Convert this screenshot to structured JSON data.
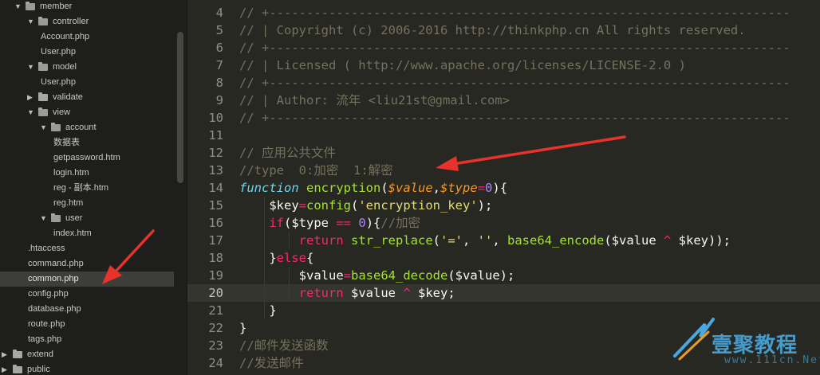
{
  "sidebar": {
    "items": [
      {
        "label": "member",
        "kind": "folder-open"
      },
      {
        "label": "controller",
        "kind": "folder-open"
      },
      {
        "label": "Account.php",
        "kind": "file"
      },
      {
        "label": "User.php",
        "kind": "file"
      },
      {
        "label": "model",
        "kind": "folder-open"
      },
      {
        "label": "User.php",
        "kind": "file"
      },
      {
        "label": "validate",
        "kind": "folder-closed"
      },
      {
        "label": "view",
        "kind": "folder-open"
      },
      {
        "label": "account",
        "kind": "folder-open"
      },
      {
        "label": "数据表",
        "kind": "file"
      },
      {
        "label": "getpassword.htm",
        "kind": "file"
      },
      {
        "label": "login.htm",
        "kind": "file"
      },
      {
        "label": "reg - 副本.htm",
        "kind": "file"
      },
      {
        "label": "reg.htm",
        "kind": "file"
      },
      {
        "label": "user",
        "kind": "folder-open"
      },
      {
        "label": "index.htm",
        "kind": "file"
      },
      {
        "label": ".htaccess",
        "kind": "file"
      },
      {
        "label": "command.php",
        "kind": "file"
      },
      {
        "label": "common.php",
        "kind": "file",
        "selected": true
      },
      {
        "label": "config.php",
        "kind": "file"
      },
      {
        "label": "database.php",
        "kind": "file"
      },
      {
        "label": "route.php",
        "kind": "file"
      },
      {
        "label": "tags.php",
        "kind": "file"
      },
      {
        "label": "extend",
        "kind": "folder-closed"
      },
      {
        "label": "public",
        "kind": "folder-closed"
      }
    ]
  },
  "editor": {
    "current_line": "20",
    "lines": [
      {
        "num": "4",
        "tokens": [
          [
            "c",
            "// +----------------------------------------------------------------------"
          ]
        ]
      },
      {
        "num": "5",
        "tokens": [
          [
            "c",
            "// | Copyright (c) 2006-2016 http://thinkphp.cn All rights reserved."
          ]
        ]
      },
      {
        "num": "6",
        "tokens": [
          [
            "c",
            "// +----------------------------------------------------------------------"
          ]
        ]
      },
      {
        "num": "7",
        "tokens": [
          [
            "c",
            "// | Licensed ( http://www.apache.org/licenses/LICENSE-2.0 )"
          ]
        ]
      },
      {
        "num": "8",
        "tokens": [
          [
            "c",
            "// +----------------------------------------------------------------------"
          ]
        ]
      },
      {
        "num": "9",
        "tokens": [
          [
            "c",
            "// | Author: 流年 <liu21st@gmail.com>"
          ]
        ]
      },
      {
        "num": "10",
        "tokens": [
          [
            "c",
            "// +----------------------------------------------------------------------"
          ]
        ]
      },
      {
        "num": "11",
        "tokens": []
      },
      {
        "num": "12",
        "tokens": [
          [
            "c",
            "// 应用公共文件"
          ]
        ]
      },
      {
        "num": "13",
        "tokens": [
          [
            "c",
            "//type  0:加密  1:解密"
          ]
        ]
      },
      {
        "num": "14",
        "tokens": [
          [
            "d",
            "function"
          ],
          [
            "p",
            " "
          ],
          [
            "f",
            "encryption"
          ],
          [
            "p",
            "("
          ],
          [
            "v",
            "$value"
          ],
          [
            "p",
            ","
          ],
          [
            "v",
            "$type"
          ],
          [
            "k",
            "="
          ],
          [
            "n",
            "0"
          ],
          [
            "p",
            "){"
          ]
        ]
      },
      {
        "num": "15",
        "tokens": [
          [
            "p",
            "    $key"
          ],
          [
            "k",
            "="
          ],
          [
            "f",
            "config"
          ],
          [
            "p",
            "("
          ],
          [
            "s",
            "'encryption_key'"
          ],
          [
            "p",
            ");"
          ]
        ]
      },
      {
        "num": "16",
        "tokens": [
          [
            "p",
            "    "
          ],
          [
            "k",
            "if"
          ],
          [
            "p",
            "($type "
          ],
          [
            "k",
            "=="
          ],
          [
            "p",
            " "
          ],
          [
            "n",
            "0"
          ],
          [
            "p",
            "){"
          ],
          [
            "c",
            "//加密"
          ]
        ]
      },
      {
        "num": "17",
        "tokens": [
          [
            "p",
            "        "
          ],
          [
            "k",
            "return"
          ],
          [
            "p",
            " "
          ],
          [
            "f",
            "str_replace"
          ],
          [
            "p",
            "("
          ],
          [
            "s",
            "'='"
          ],
          [
            "p",
            ", "
          ],
          [
            "s",
            "''"
          ],
          [
            "p",
            ", "
          ],
          [
            "f",
            "base64_encode"
          ],
          [
            "p",
            "($value "
          ],
          [
            "k",
            "^"
          ],
          [
            "p",
            " $key));"
          ]
        ]
      },
      {
        "num": "18",
        "tokens": [
          [
            "p",
            "    }"
          ],
          [
            "k",
            "else"
          ],
          [
            "p",
            "{"
          ]
        ]
      },
      {
        "num": "19",
        "tokens": [
          [
            "p",
            "        $value"
          ],
          [
            "k",
            "="
          ],
          [
            "f",
            "base64_decode"
          ],
          [
            "p",
            "($value);"
          ]
        ]
      },
      {
        "num": "20",
        "tokens": [
          [
            "p",
            "        "
          ],
          [
            "k",
            "return"
          ],
          [
            "p",
            " $value "
          ],
          [
            "k",
            "^"
          ],
          [
            "p",
            " $key;"
          ]
        ]
      },
      {
        "num": "21",
        "tokens": [
          [
            "p",
            "    }"
          ]
        ]
      },
      {
        "num": "22",
        "tokens": [
          [
            "p",
            "}"
          ]
        ]
      },
      {
        "num": "23",
        "tokens": [
          [
            "c",
            "//邮件发送函数"
          ]
        ]
      },
      {
        "num": "24",
        "tokens": [
          [
            "c",
            "//发送邮件"
          ]
        ]
      }
    ]
  },
  "watermark": {
    "text": "壹聚教程",
    "url": "www.111cn.Net"
  },
  "colors": {
    "annotation_arrow": "#e8322b",
    "watermark": "#4aa8e0"
  }
}
